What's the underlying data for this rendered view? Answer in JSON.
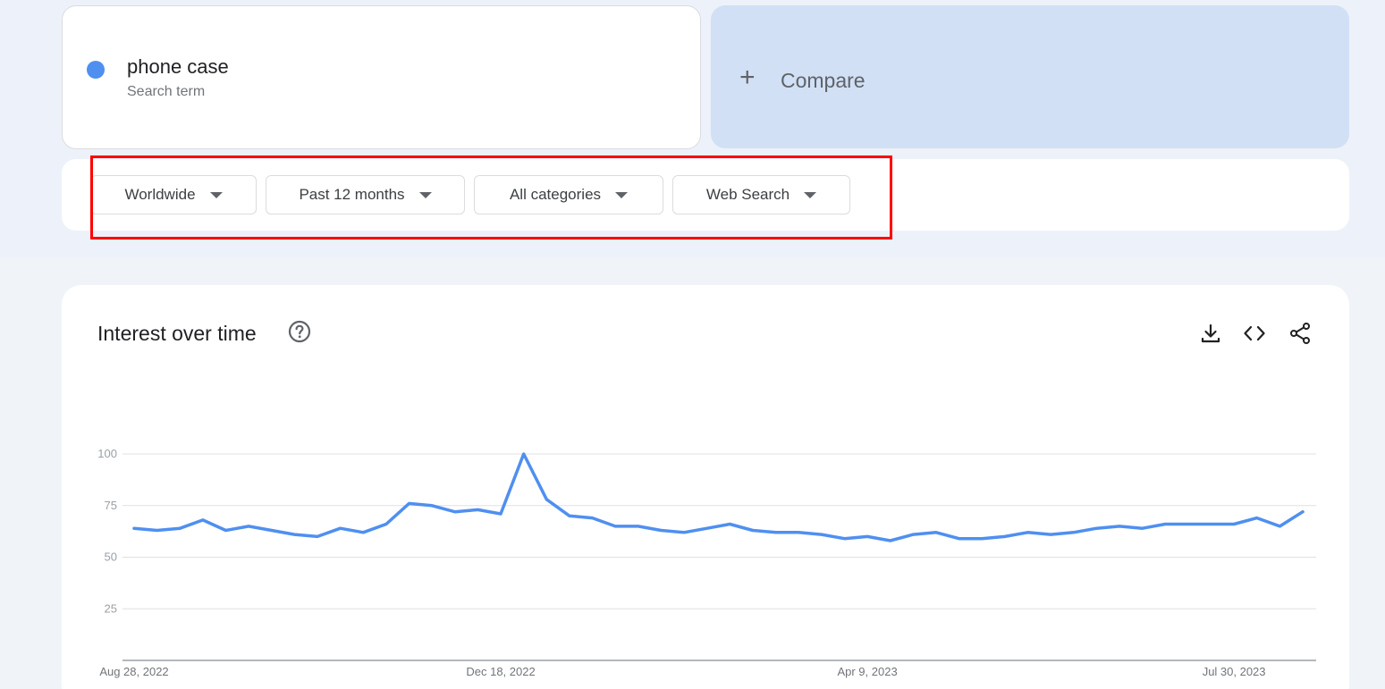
{
  "search_term": {
    "name": "phone case",
    "sub": "Search term",
    "dot_color": "#4f8ff0"
  },
  "compare": {
    "icon": "plus-icon",
    "label": "Compare"
  },
  "filters": [
    {
      "label": "Worldwide",
      "icon": "caret-down-icon"
    },
    {
      "label": "Past 12 months",
      "icon": "caret-down-icon"
    },
    {
      "label": "All categories",
      "icon": "caret-down-icon"
    },
    {
      "label": "Web Search",
      "icon": "caret-down-icon"
    }
  ],
  "annotation": {
    "color": "#ff0000"
  },
  "chart": {
    "title": "Interest over time",
    "help_icon": "help-circle-icon",
    "tools": [
      "download-icon",
      "embed-code-icon",
      "share-icon"
    ]
  },
  "chart_data": {
    "type": "line",
    "title": "Interest over time",
    "xlabel": "",
    "ylabel": "",
    "ylim": [
      0,
      100
    ],
    "yticks": [
      25,
      50,
      75,
      100
    ],
    "grid": true,
    "xtick_labels": [
      {
        "label": "Aug 28, 2022",
        "index": 0
      },
      {
        "label": "Dec 18, 2022",
        "index": 16
      },
      {
        "label": "Apr 9, 2023",
        "index": 32
      },
      {
        "label": "Jul 30, 2023",
        "index": 48
      }
    ],
    "series": [
      {
        "color": "#4f8ff0",
        "values": [
          64,
          63,
          64,
          68,
          63,
          65,
          63,
          61,
          60,
          64,
          62,
          66,
          76,
          75,
          72,
          73,
          71,
          100,
          78,
          70,
          69,
          65,
          65,
          63,
          62,
          64,
          66,
          63,
          62,
          62,
          61,
          59,
          60,
          58,
          61,
          62,
          59,
          59,
          60,
          62,
          61,
          62,
          64,
          65,
          64,
          66,
          66,
          66,
          66,
          69,
          65,
          72
        ]
      }
    ]
  }
}
